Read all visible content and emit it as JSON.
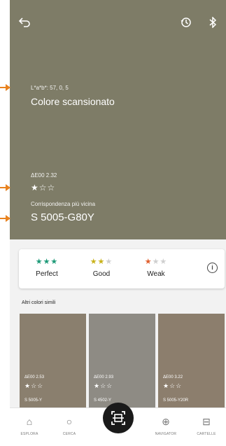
{
  "accent_color": "#e8821f",
  "top_bar": {
    "back_icon": "back-arrow-icon",
    "history_icon": "history-icon",
    "bluetooth_icon": "bluetooth-icon"
  },
  "scan": {
    "color": "#7e7c67",
    "lab_text": "L*a*b*: 57, 0, 5",
    "title": "Colore scansionato",
    "delta_e": "ΔE00 2.32",
    "stars": "★☆☆",
    "closest_label": "Corrispondenza più vicina",
    "closest_code": "S 5005-G80Y"
  },
  "legend": {
    "items": [
      {
        "stars": "★★★",
        "label": "Perfect",
        "color": "#1e9a78"
      },
      {
        "stars": "★★★",
        "label": "Good",
        "color": "#c9b21a"
      },
      {
        "stars": "★★★",
        "label": "Weak",
        "color": "#e0602f"
      }
    ],
    "info_icon": "info-icon"
  },
  "similar": {
    "title": "Altri colori simili",
    "items": [
      {
        "delta": "ΔE00 2.53",
        "stars": "★☆☆",
        "code": "S 5005-Y",
        "color": "#8a7f6e"
      },
      {
        "delta": "ΔE00 2.93",
        "stars": "★☆☆",
        "code": "S 4502-Y",
        "color": "#8e8b84"
      },
      {
        "delta": "ΔE00 3.22",
        "stars": "★☆☆",
        "code": "S 5005-Y20R",
        "color": "#8c7e6d"
      }
    ]
  },
  "nav": {
    "items": [
      {
        "label": "ESPLORA",
        "icon": "home-icon",
        "glyph": "⌂"
      },
      {
        "label": "CERCA",
        "icon": "search-icon",
        "glyph": "○"
      },
      {
        "label": "",
        "icon": "scan-icon",
        "glyph": ""
      },
      {
        "label": "NAVIGATOR",
        "icon": "navigator-icon",
        "glyph": "⊕"
      },
      {
        "label": "CARTELLE",
        "icon": "folder-icon",
        "glyph": "⊟"
      }
    ]
  }
}
